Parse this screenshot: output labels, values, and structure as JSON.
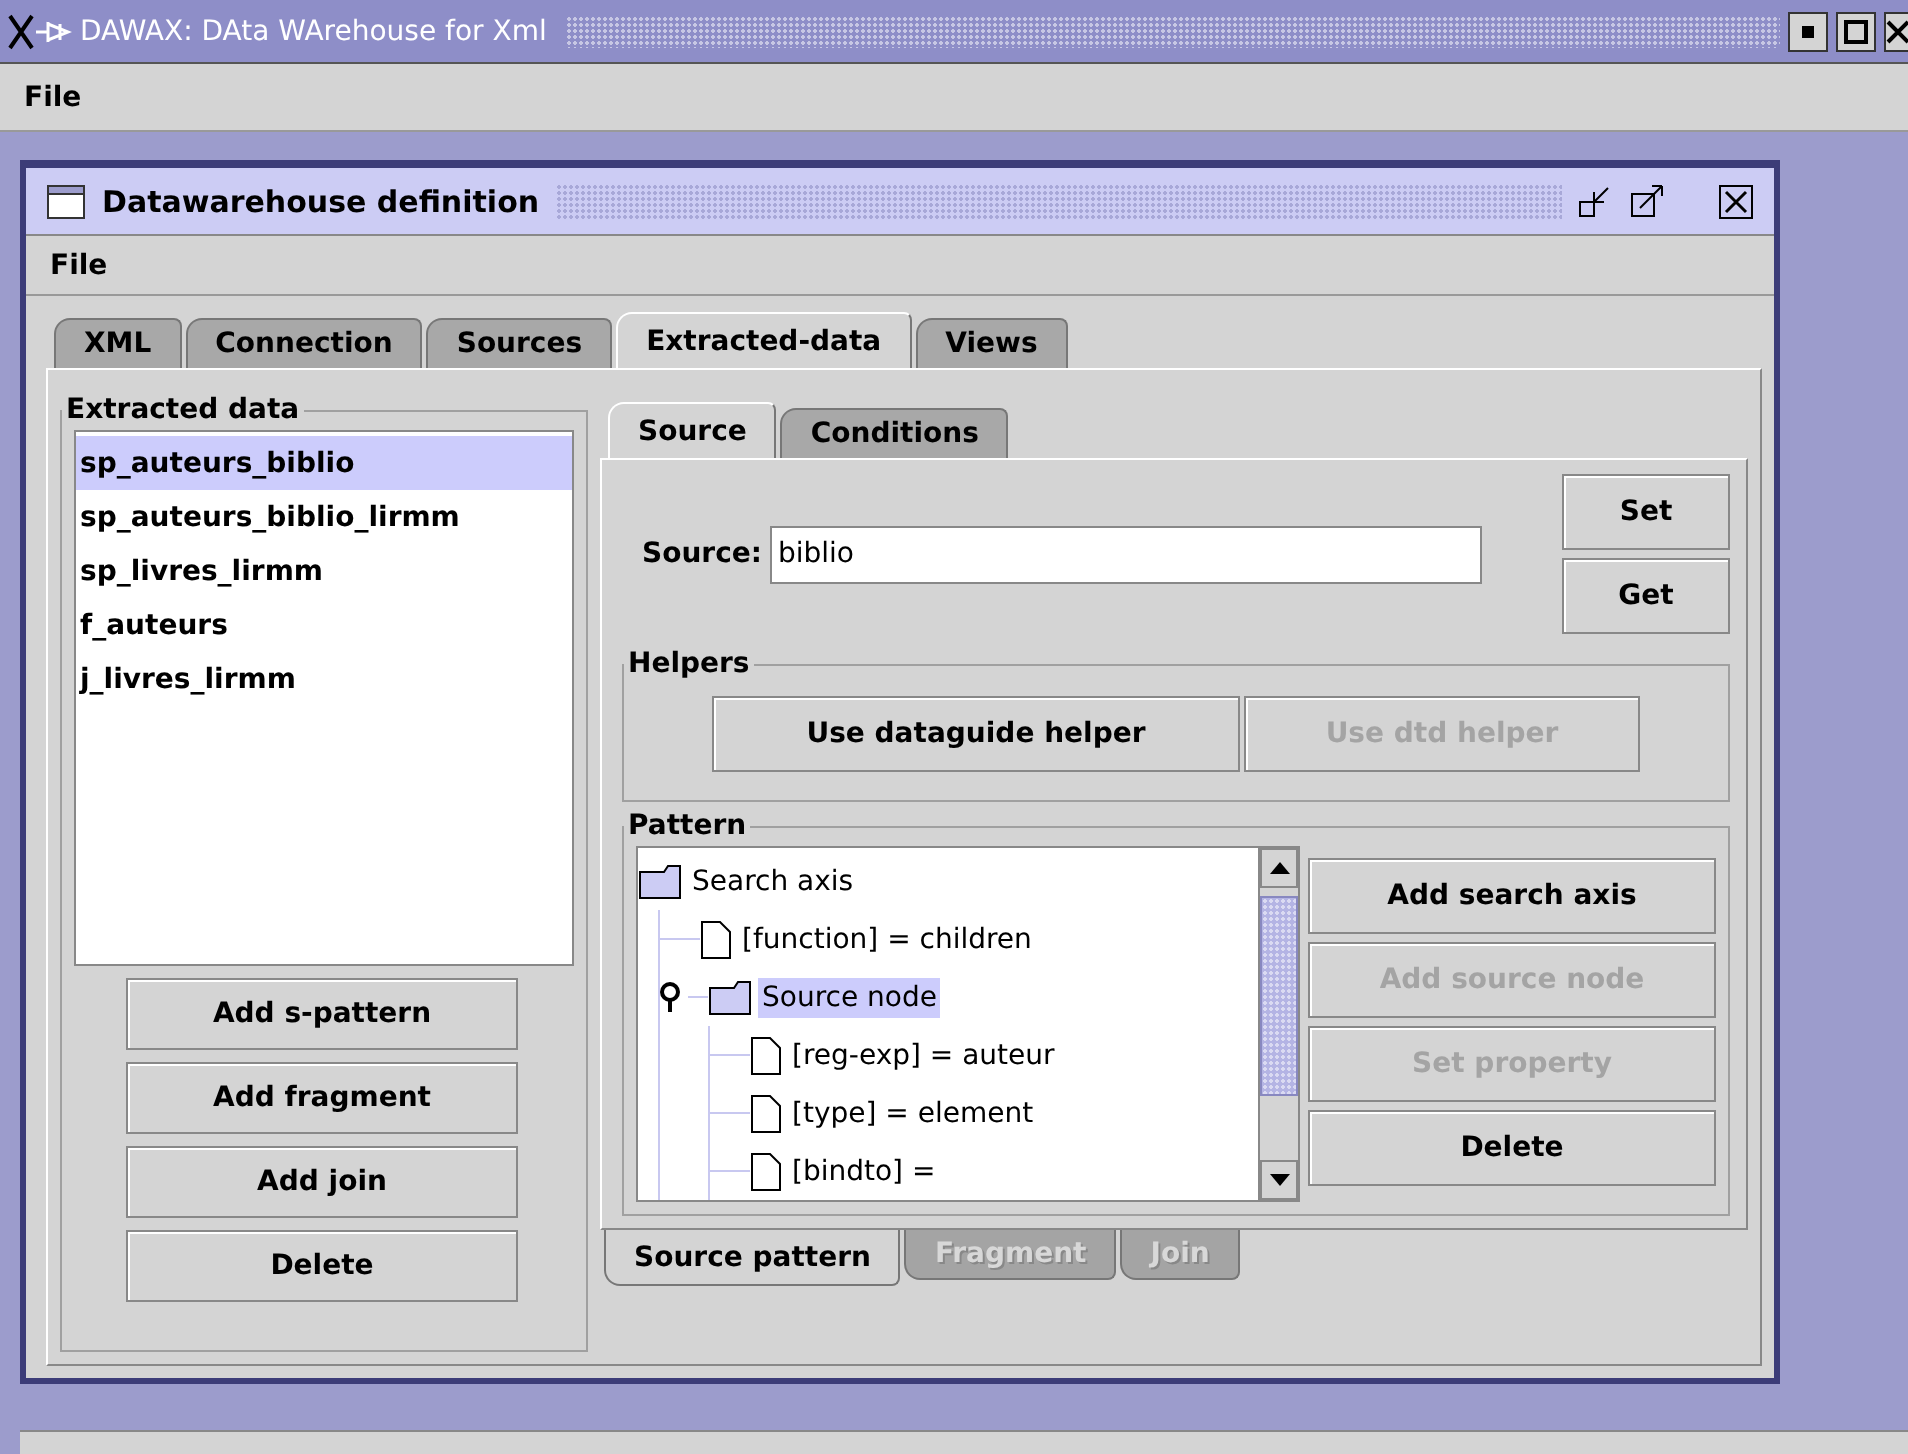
{
  "window": {
    "title": "DAWAX: DAta WArehouse for Xml",
    "menu": [
      "File"
    ]
  },
  "frame": {
    "title": "Datawarehouse definition",
    "menu": [
      "File"
    ],
    "tabs": [
      {
        "label": "XML",
        "selected": false
      },
      {
        "label": "Connection",
        "selected": false
      },
      {
        "label": "Sources",
        "selected": false
      },
      {
        "label": "Extracted-data",
        "selected": true
      },
      {
        "label": "Views",
        "selected": false
      }
    ],
    "extracted_data": {
      "title": "Extracted data",
      "items": [
        {
          "label": "sp_auteurs_biblio",
          "selected": true
        },
        {
          "label": "sp_auteurs_biblio_lirmm",
          "selected": false
        },
        {
          "label": "sp_livres_lirmm",
          "selected": false
        },
        {
          "label": "f_auteurs",
          "selected": false
        },
        {
          "label": "j_livres_lirmm",
          "selected": false
        }
      ],
      "buttons": [
        {
          "label": "Add s-pattern",
          "disabled": false
        },
        {
          "label": "Add fragment",
          "disabled": false
        },
        {
          "label": "Add join",
          "disabled": false
        },
        {
          "label": "Delete",
          "disabled": false
        }
      ]
    },
    "source_panel": {
      "tabs": [
        {
          "label": "Source",
          "selected": true
        },
        {
          "label": "Conditions",
          "selected": false
        }
      ],
      "source_label": "Source:",
      "source_value": "biblio",
      "buttons": [
        {
          "label": "Set",
          "disabled": false
        },
        {
          "label": "Get",
          "disabled": false
        }
      ],
      "helpers": {
        "title": "Helpers",
        "buttons": [
          {
            "label": "Use dataguide helper",
            "disabled": false
          },
          {
            "label": "Use dtd helper",
            "disabled": true
          }
        ]
      },
      "pattern": {
        "title": "Pattern",
        "tree": [
          {
            "label": "Search axis",
            "kind": "folder",
            "selected": false,
            "children": [
              {
                "label": "[function] = children",
                "kind": "file",
                "selected": false
              },
              {
                "label": "Source node",
                "kind": "folder",
                "selected": true,
                "expanded": true,
                "children": [
                  {
                    "label": "[reg-exp] = auteur",
                    "kind": "file",
                    "selected": false
                  },
                  {
                    "label": "[type] = element",
                    "kind": "file",
                    "selected": false
                  },
                  {
                    "label": "[bindto] =",
                    "kind": "file",
                    "selected": false
                  }
                ]
              }
            ]
          }
        ],
        "buttons": [
          {
            "label": "Add search axis",
            "disabled": false
          },
          {
            "label": "Add source node",
            "disabled": true
          },
          {
            "label": "Set property",
            "disabled": true
          },
          {
            "label": "Delete",
            "disabled": false
          }
        ]
      }
    },
    "bottom_tabs": [
      {
        "label": "Source pattern",
        "selected": true,
        "disabled": false
      },
      {
        "label": "Fragment",
        "selected": false,
        "disabled": true
      },
      {
        "label": "Join",
        "selected": false,
        "disabled": true
      }
    ]
  }
}
